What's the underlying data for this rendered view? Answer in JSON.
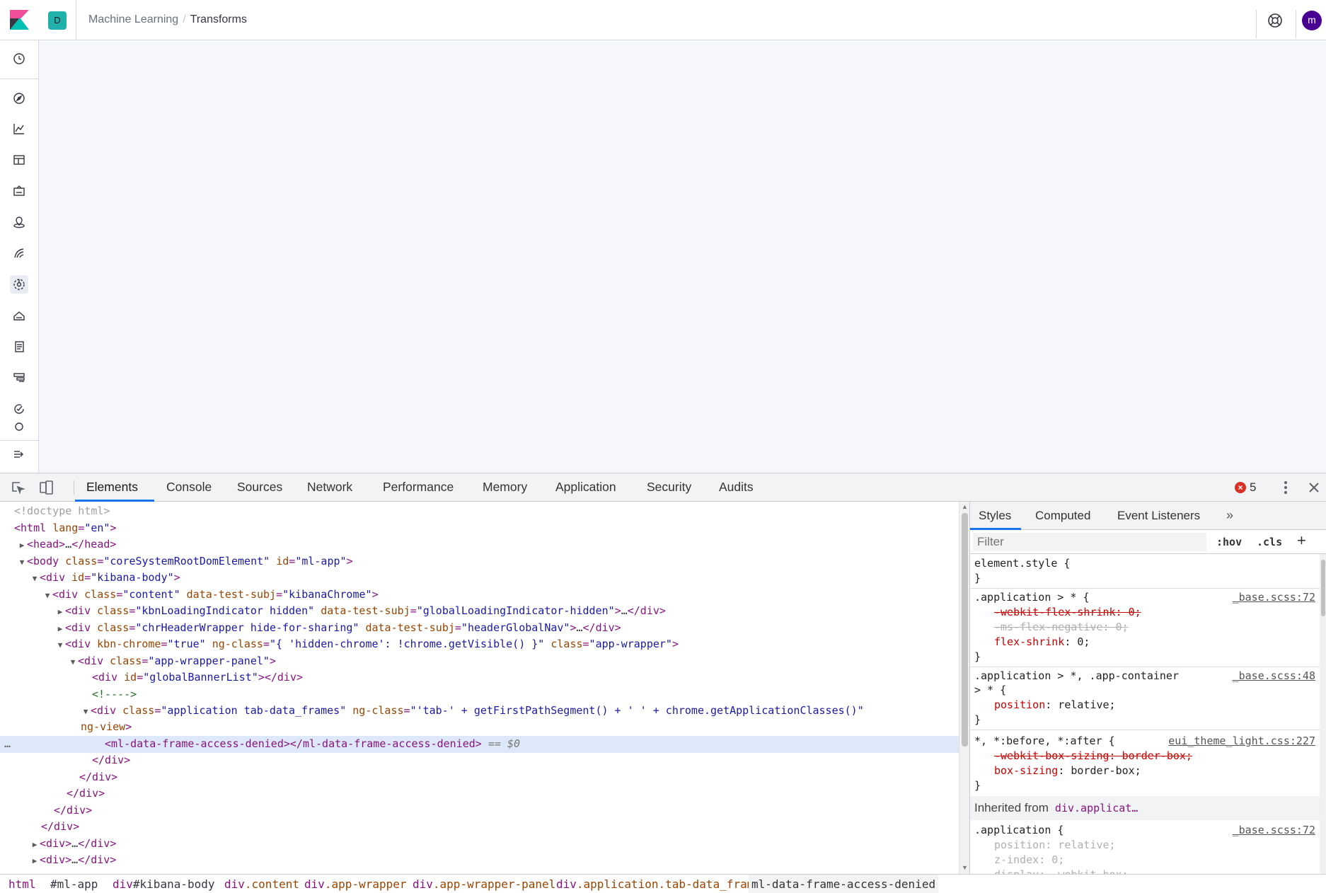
{
  "header": {
    "space_initial": "D",
    "breadcrumbs": [
      "Machine Learning",
      "Transforms"
    ],
    "avatar_initial": "m"
  },
  "sidenav": {
    "icons": [
      "recent-icon",
      "discover-icon",
      "visualize-icon",
      "dashboard-icon",
      "canvas-icon",
      "maps-icon",
      "ml-icon",
      "ml-active-icon",
      "infrastructure-icon",
      "logs-icon",
      "apm-icon",
      "uptime-icon",
      "siem-icon",
      "collapse-icon"
    ]
  },
  "devtools": {
    "tabs": [
      "Elements",
      "Console",
      "Sources",
      "Network",
      "Performance",
      "Memory",
      "Application",
      "Security",
      "Audits"
    ],
    "error_count": "5",
    "dom_lines": [
      {
        "text": "<!doctype html>"
      },
      {
        "text": "<html lang=\"en\">"
      },
      {
        "text": "<head>…</head>"
      },
      {
        "text": "<body class=\"coreSystemRootDomElement\" id=\"ml-app\">"
      },
      {
        "text": "<div id=\"kibana-body\">"
      },
      {
        "text": "<div class=\"content\" data-test-subj=\"kibanaChrome\">"
      },
      {
        "text": "<div class=\"kbnLoadingIndicator hidden\" data-test-subj=\"globalLoadingIndicator-hidden\">…</div>"
      },
      {
        "text": "<div class=\"chrHeaderWrapper hide-for-sharing\" data-test-subj=\"headerGlobalNav\">…</div>"
      },
      {
        "text": "<div kbn-chrome=\"true\" ng-class=\"{ 'hidden-chrome': !chrome.getVisible() }\" class=\"app-wrapper\">"
      },
      {
        "text": "<div class=\"app-wrapper-panel\">"
      },
      {
        "text": "<div id=\"globalBannerList\"></div>"
      },
      {
        "text": "<!---->"
      },
      {
        "text": "<div class=\"application tab-data_frames\" ng-class=\"'tab-' + getFirstPathSegment() + ' ' + chrome.getApplicationClasses()\""
      },
      {
        "text": "ng-view>"
      },
      {
        "text": "<ml-data-frame-access-denied></ml-data-frame-access-denied> == $0"
      },
      {
        "text": "</div>"
      },
      {
        "text": "</div>"
      },
      {
        "text": "</div>"
      },
      {
        "text": "</div>"
      },
      {
        "text": "</div>"
      },
      {
        "text": "<div>…</div>"
      },
      {
        "text": "<div>…</div>"
      }
    ],
    "styles_tabs": [
      "Styles",
      "Computed",
      "Event Listeners"
    ],
    "filter_placeholder": "Filter",
    "hov_label": ":hov",
    "cls_label": ".cls",
    "rules": {
      "element_style": "element.style {",
      "r1_selector": ".application > * {",
      "r1_source": "_base.scss:72",
      "r1_p1": "-webkit-flex-shrink: 0;",
      "r1_p2": "-ms-flex-negative: 0;",
      "r1_p3_name": "flex-shrink",
      "r1_p3_val": ": 0;",
      "r2_selector": ".application > *, .app-container",
      "r2_selector_cont": "> * {",
      "r2_source": "_base.scss:48",
      "r2_p1_name": "position",
      "r2_p1_val": ": relative;",
      "r3_selector": "*, *:before, *:after {",
      "r3_source": "eui_theme_light.css:227",
      "r3_p1": "-webkit-box-sizing: border-box;",
      "r3_p2_name": "box-sizing",
      "r3_p2_val": ": border-box;",
      "inherited_label": "Inherited from",
      "inherited_sel": "div.applicat…",
      "r4_selector": ".application {",
      "r4_source": "_base.scss:72",
      "r4_p1": "position: relative;",
      "r4_p2": "z-index: 0;",
      "r4_p3": "display: -webkit-box;",
      "brace_close": "}"
    },
    "crumbs": [
      {
        "tag": "html",
        "rest": ""
      },
      {
        "tag": "",
        "rest": "#ml-app",
        "plain": true
      },
      {
        "tag": "div",
        "rest": "#kibana-body"
      },
      {
        "tag": "div",
        "rest": ".content"
      },
      {
        "tag": "div",
        "rest": ".app-wrapper"
      },
      {
        "tag": "div",
        "rest": ".app-wrapper-panel"
      },
      {
        "tag": "div",
        "rest": ".application.tab-data_frames"
      },
      {
        "tag": "",
        "rest": "ml-data-frame-access-denied",
        "plain": true
      }
    ]
  }
}
